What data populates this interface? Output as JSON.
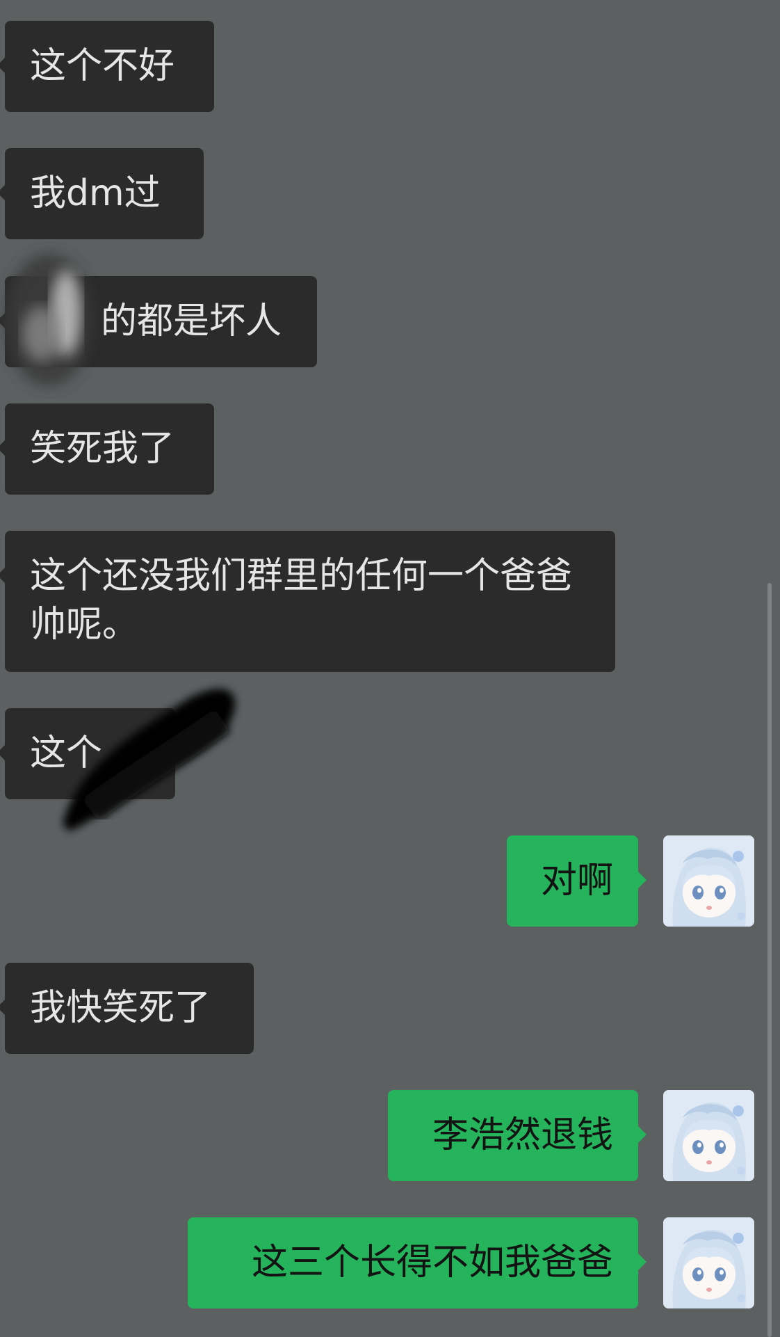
{
  "chat": {
    "messages": [
      {
        "side": "in",
        "text": "这个不好"
      },
      {
        "side": "in",
        "text": "我dm过"
      },
      {
        "side": "in",
        "text": "的都是坏人"
      },
      {
        "side": "in",
        "text": "笑死我了"
      },
      {
        "side": "in",
        "text": "这个还没我们群里的任何一个爸爸帅呢。"
      },
      {
        "side": "in",
        "text": "这个"
      },
      {
        "side": "out",
        "text": "对啊",
        "avatar_icon": "anime-girl-avatar-icon"
      },
      {
        "side": "in",
        "text": "我快笑死了"
      },
      {
        "side": "out",
        "text": "李浩然退钱",
        "avatar_icon": "anime-girl-avatar-icon"
      },
      {
        "side": "out",
        "text": "这三个长得不如我爸爸",
        "avatar_icon": "anime-girl-avatar-icon"
      }
    ]
  },
  "colors": {
    "background": "#5c6061",
    "incoming_bubble": "#2b2b2b",
    "incoming_text": "#e6e6e6",
    "outgoing_bubble": "#25b45c",
    "outgoing_text": "#131313"
  }
}
